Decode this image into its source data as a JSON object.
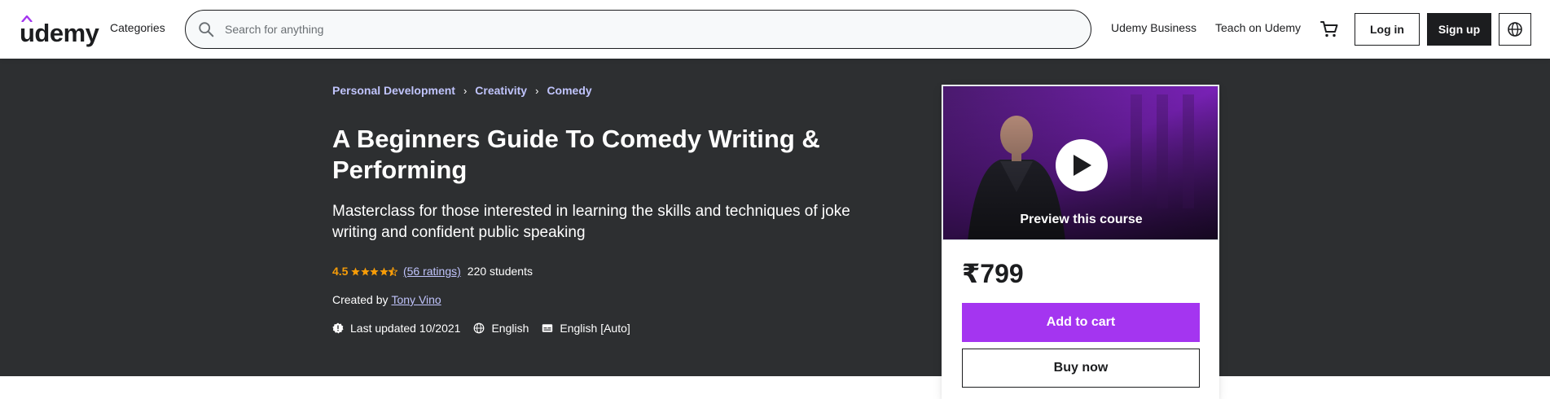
{
  "header": {
    "logo_text": "udemy",
    "categories_label": "Categories",
    "search_placeholder": "Search for anything",
    "business_label": "Udemy Business",
    "teach_label": "Teach on Udemy",
    "login_label": "Log in",
    "signup_label": "Sign up"
  },
  "breadcrumb": [
    {
      "label": "Personal Development"
    },
    {
      "label": "Creativity"
    },
    {
      "label": "Comedy"
    }
  ],
  "course": {
    "title": "A Beginners Guide To Comedy Writing & Performing",
    "subtitle": "Masterclass for those interested in learning the skills and techniques of joke writing and confident public speaking",
    "rating": "4.5",
    "rating_stars": 4.5,
    "ratings_count": "(56 ratings)",
    "students": "220 students",
    "created_by_label": "Created by",
    "author": "Tony Vino",
    "last_updated": "Last updated 10/2021",
    "language": "English",
    "captions": "English [Auto]"
  },
  "card": {
    "preview_label": "Preview this course",
    "price": "₹799",
    "add_to_cart_label": "Add to cart",
    "buy_now_label": "Buy now"
  },
  "colors": {
    "accent_purple": "#a435f0",
    "hero_bg": "#2d2f31",
    "rating_orange": "#f69c08",
    "link_lavender": "#c0c4fc"
  },
  "icons": [
    "search-icon",
    "cart-icon",
    "globe-icon",
    "play-icon",
    "alert-icon",
    "language-icon",
    "captions-icon",
    "star-icon"
  ]
}
